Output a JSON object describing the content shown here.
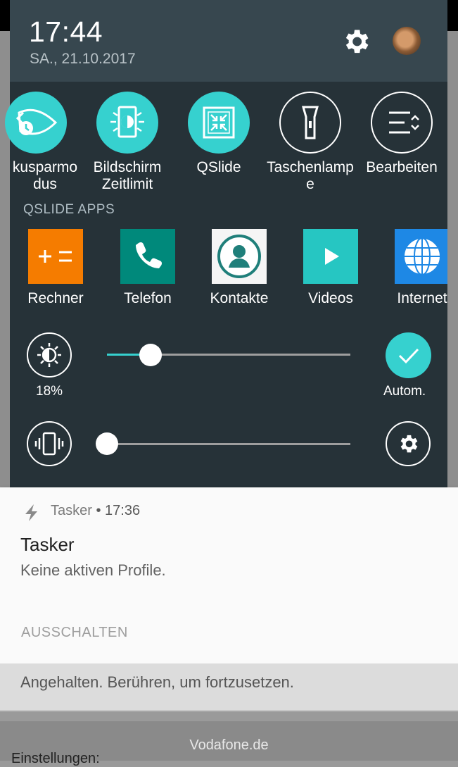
{
  "status": {
    "time": "17:44",
    "date": "SA., 21.10.2017"
  },
  "quick_settings": [
    {
      "label": "kusparmo\ndus",
      "icon": "eco-mode-icon",
      "active": true
    },
    {
      "label": "Bildschirm Zeitlimit",
      "icon": "screen-timeout-icon",
      "active": true
    },
    {
      "label": "QSlide",
      "icon": "qslide-icon",
      "active": true
    },
    {
      "label": "Taschenlamp\ne",
      "icon": "flashlight-icon",
      "active": false
    },
    {
      "label": "Bearbeiten",
      "icon": "edit-list-icon",
      "active": false
    }
  ],
  "qslide": {
    "section_title": "QSLIDE APPS",
    "apps": [
      {
        "label": "Rechner",
        "icon": "calculator-icon",
        "color": "#f57c00"
      },
      {
        "label": "Telefon",
        "icon": "phone-icon",
        "color": "#00897b"
      },
      {
        "label": "Kontakte",
        "icon": "contacts-icon",
        "color": "#f5f5f5"
      },
      {
        "label": "Videos",
        "icon": "play-icon",
        "color": "#26c6c2"
      },
      {
        "label": "Internet",
        "icon": "globe-icon",
        "color": "#1e88e5"
      }
    ]
  },
  "brightness": {
    "percent_label": "18%",
    "level": 0.18,
    "auto_label": "Autom.",
    "auto_enabled": true
  },
  "volume": {
    "level": 0.0
  },
  "notification": {
    "app": "Tasker",
    "time": "• 17:36",
    "title": "Tasker",
    "text": "Keine aktiven Profile.",
    "action": "AUSSCHALTEN"
  },
  "notification2": {
    "text": "Angehalten. Berühren, um fortzusetzen."
  },
  "footer": {
    "carrier": "Vodafone.de",
    "partial_text": "Einstellungen:"
  },
  "colors": {
    "accent": "#36d1cf",
    "panel": "#263238",
    "header": "#37474f"
  }
}
